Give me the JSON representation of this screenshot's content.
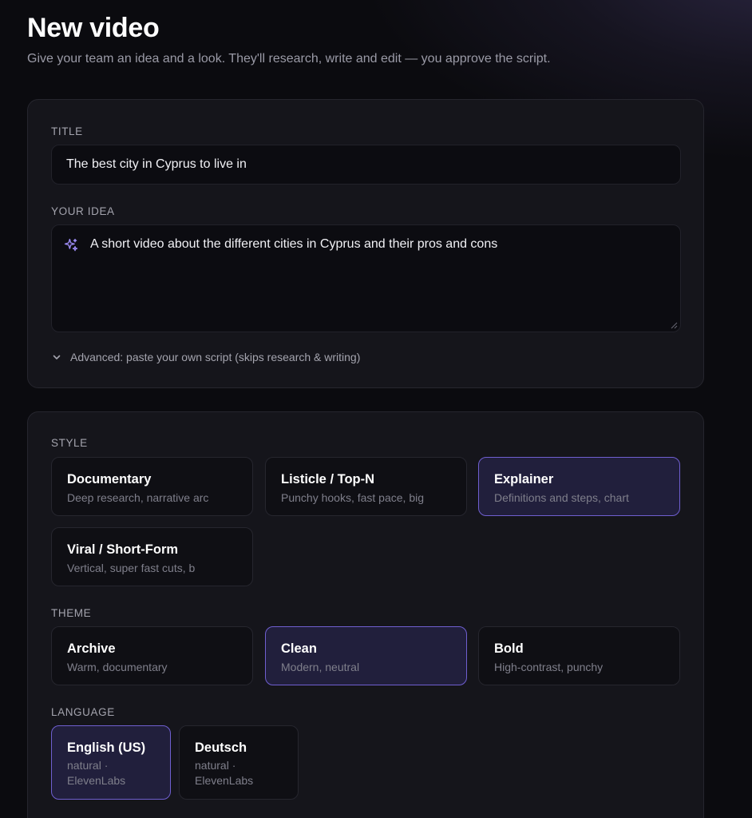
{
  "header": {
    "title": "New video",
    "subtitle": "Give your team an idea and a look. They'll research, write and edit — you approve the script."
  },
  "form": {
    "title_label": "TITLE",
    "title_value": "The best city in Cyprus to live in",
    "idea_label": "YOUR IDEA",
    "idea_value": "A short video about the different cities in Cyprus and their pros and cons",
    "advanced_label": "Advanced: paste your own script (skips research & writing)"
  },
  "style": {
    "label": "STYLE",
    "options": [
      {
        "name": "Documentary",
        "desc": "Deep research, narrative arc",
        "selected": false
      },
      {
        "name": "Listicle / Top-N",
        "desc": "Punchy hooks, fast pace, big",
        "selected": false
      },
      {
        "name": "Explainer",
        "desc": "Definitions and steps, chart",
        "selected": true
      },
      {
        "name": "Viral / Short-Form",
        "desc": "Vertical, super fast cuts, b",
        "selected": false
      }
    ]
  },
  "theme": {
    "label": "THEME",
    "options": [
      {
        "name": "Archive",
        "desc": "Warm, documentary",
        "selected": false
      },
      {
        "name": "Clean",
        "desc": "Modern, neutral",
        "selected": true
      },
      {
        "name": "Bold",
        "desc": "High-contrast, punchy",
        "selected": false
      }
    ]
  },
  "language": {
    "label": "LANGUAGE",
    "options": [
      {
        "name": "English (US)",
        "desc": "natural · ElevenLabs",
        "selected": true
      },
      {
        "name": "Deutsch",
        "desc": "natural · ElevenLabs",
        "selected": false
      }
    ]
  },
  "colors": {
    "accent_border": "#6f5fd0",
    "accent_bg": "#211f3c",
    "sparkle": "#9d8cf5"
  }
}
